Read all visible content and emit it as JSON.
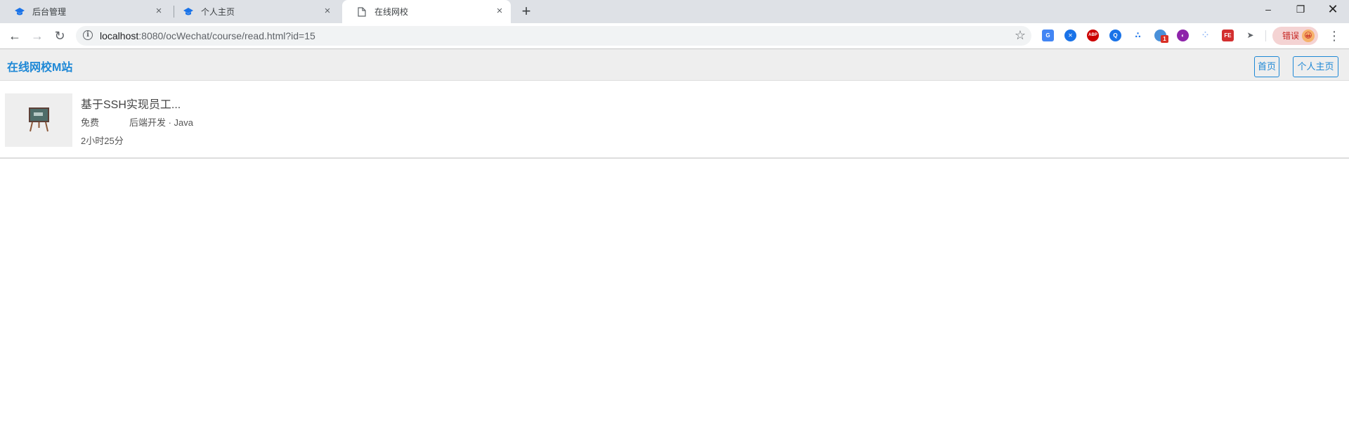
{
  "browser": {
    "tabs": [
      {
        "title": "后台管理",
        "icon": "graduation-cap-icon",
        "active": false
      },
      {
        "title": "个人主页",
        "icon": "graduation-cap-icon",
        "active": false
      },
      {
        "title": "在线网校",
        "icon": "page-icon",
        "active": true
      }
    ],
    "url": {
      "host": "localhost",
      "rest": ":8080/ocWechat/course/read.html?id=15"
    },
    "profile_label": "错误",
    "extension_badge": "1",
    "colors": {
      "tab_strip": "#dee1e6",
      "accent": "#1e88d6"
    }
  },
  "site": {
    "brand": "在线网校M站",
    "nav": {
      "home": "首页",
      "profile": "个人主页"
    }
  },
  "course": {
    "title": "基于SSH实现员工...",
    "price": "免费",
    "category": "后端开发 · Java",
    "duration": "2小时25分"
  }
}
